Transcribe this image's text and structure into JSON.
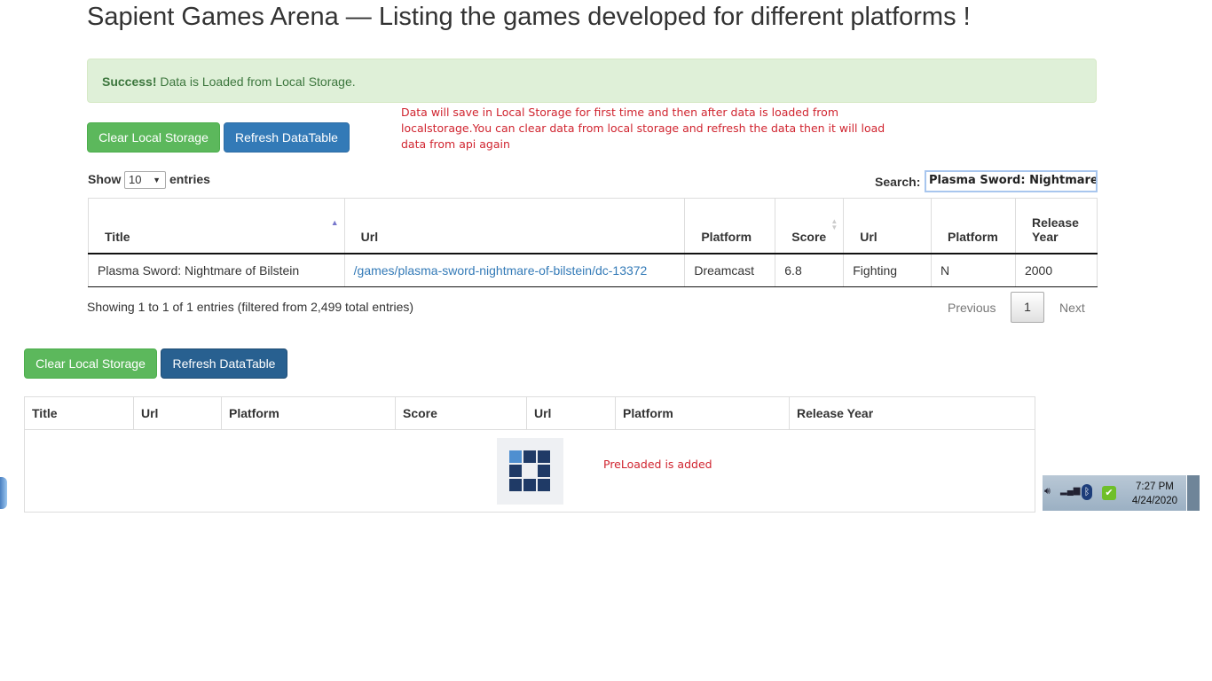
{
  "page": {
    "title": "Sapient Games Arena — Listing the games developed for different platforms !"
  },
  "alert": {
    "strong": "Success!",
    "message": " Data is Loaded from Local Storage."
  },
  "buttons": {
    "clear_label": "Clear Local Storage",
    "refresh_label": "Refresh DataTable"
  },
  "note_text": "Data will save in Local Storage for first time and then after data is loaded from localstorage.You can clear data from local storage and refresh the data then it will load data from api again",
  "length_menu": {
    "show_label": "Show",
    "selected": "10",
    "entries_label": "entries"
  },
  "search": {
    "label": "Search:",
    "value": "Plasma Sword: Nightmare o"
  },
  "table": {
    "headers": [
      "Title",
      "Url",
      "Platform",
      "Score",
      "Url",
      "Platform",
      "Release Year"
    ],
    "rows": [
      [
        "Plasma Sword: Nightmare of Bilstein",
        "/games/plasma-sword-nightmare-of-bilstein/dc-13372",
        "Dreamcast",
        "6.8",
        "Fighting",
        "N",
        "2000"
      ]
    ]
  },
  "info_text": "Showing 1 to 1 of 1 entries (filtered from 2,499 total entries)",
  "pagination": {
    "previous": "Previous",
    "current": "1",
    "next": "Next"
  },
  "table2": {
    "headers": [
      "Title",
      "Url",
      "Platform",
      "Score",
      "Url",
      "Platform",
      "Release Year"
    ]
  },
  "preload_text": "PreLoaded is added",
  "taskbar": {
    "time": "7:27 PM",
    "date": "4/24/2020"
  },
  "colors": {
    "success": "#5cb85c",
    "primary": "#337ab7",
    "note_red": "#d0242f",
    "alert_bg": "#dff0d8"
  }
}
